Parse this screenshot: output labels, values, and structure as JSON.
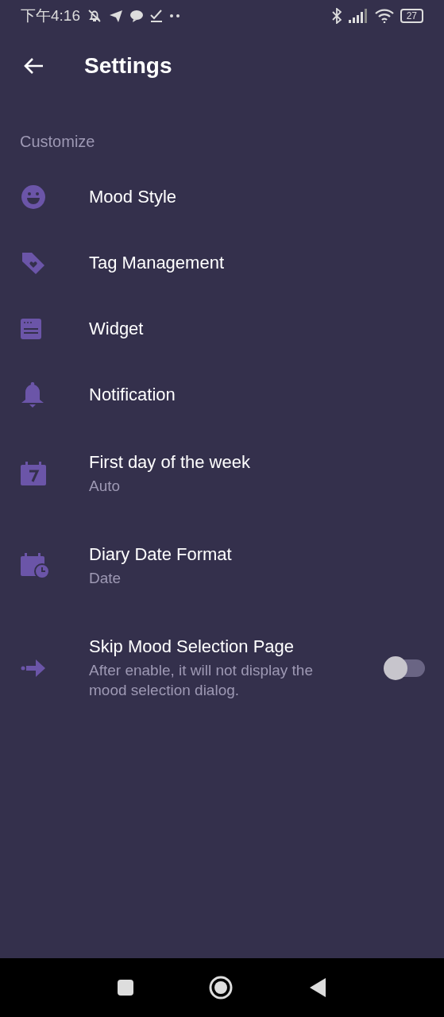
{
  "status_bar": {
    "time": "下午4:16",
    "battery": "27"
  },
  "header": {
    "title": "Settings"
  },
  "sections": [
    {
      "title": "Customize",
      "items": [
        {
          "kind": "link",
          "title": "Mood Style"
        },
        {
          "kind": "link",
          "title": "Tag Management"
        },
        {
          "kind": "link",
          "title": "Widget"
        },
        {
          "kind": "link",
          "title": "Notification"
        },
        {
          "kind": "link",
          "title": "First day of the week",
          "subtitle": "Auto"
        },
        {
          "kind": "link",
          "title": "Diary Date Format",
          "subtitle": "Date"
        },
        {
          "kind": "switch",
          "title": "Skip Mood Selection Page",
          "subtitle": "After enable, it will not display the mood selection dialog.",
          "on": false
        }
      ]
    }
  ]
}
